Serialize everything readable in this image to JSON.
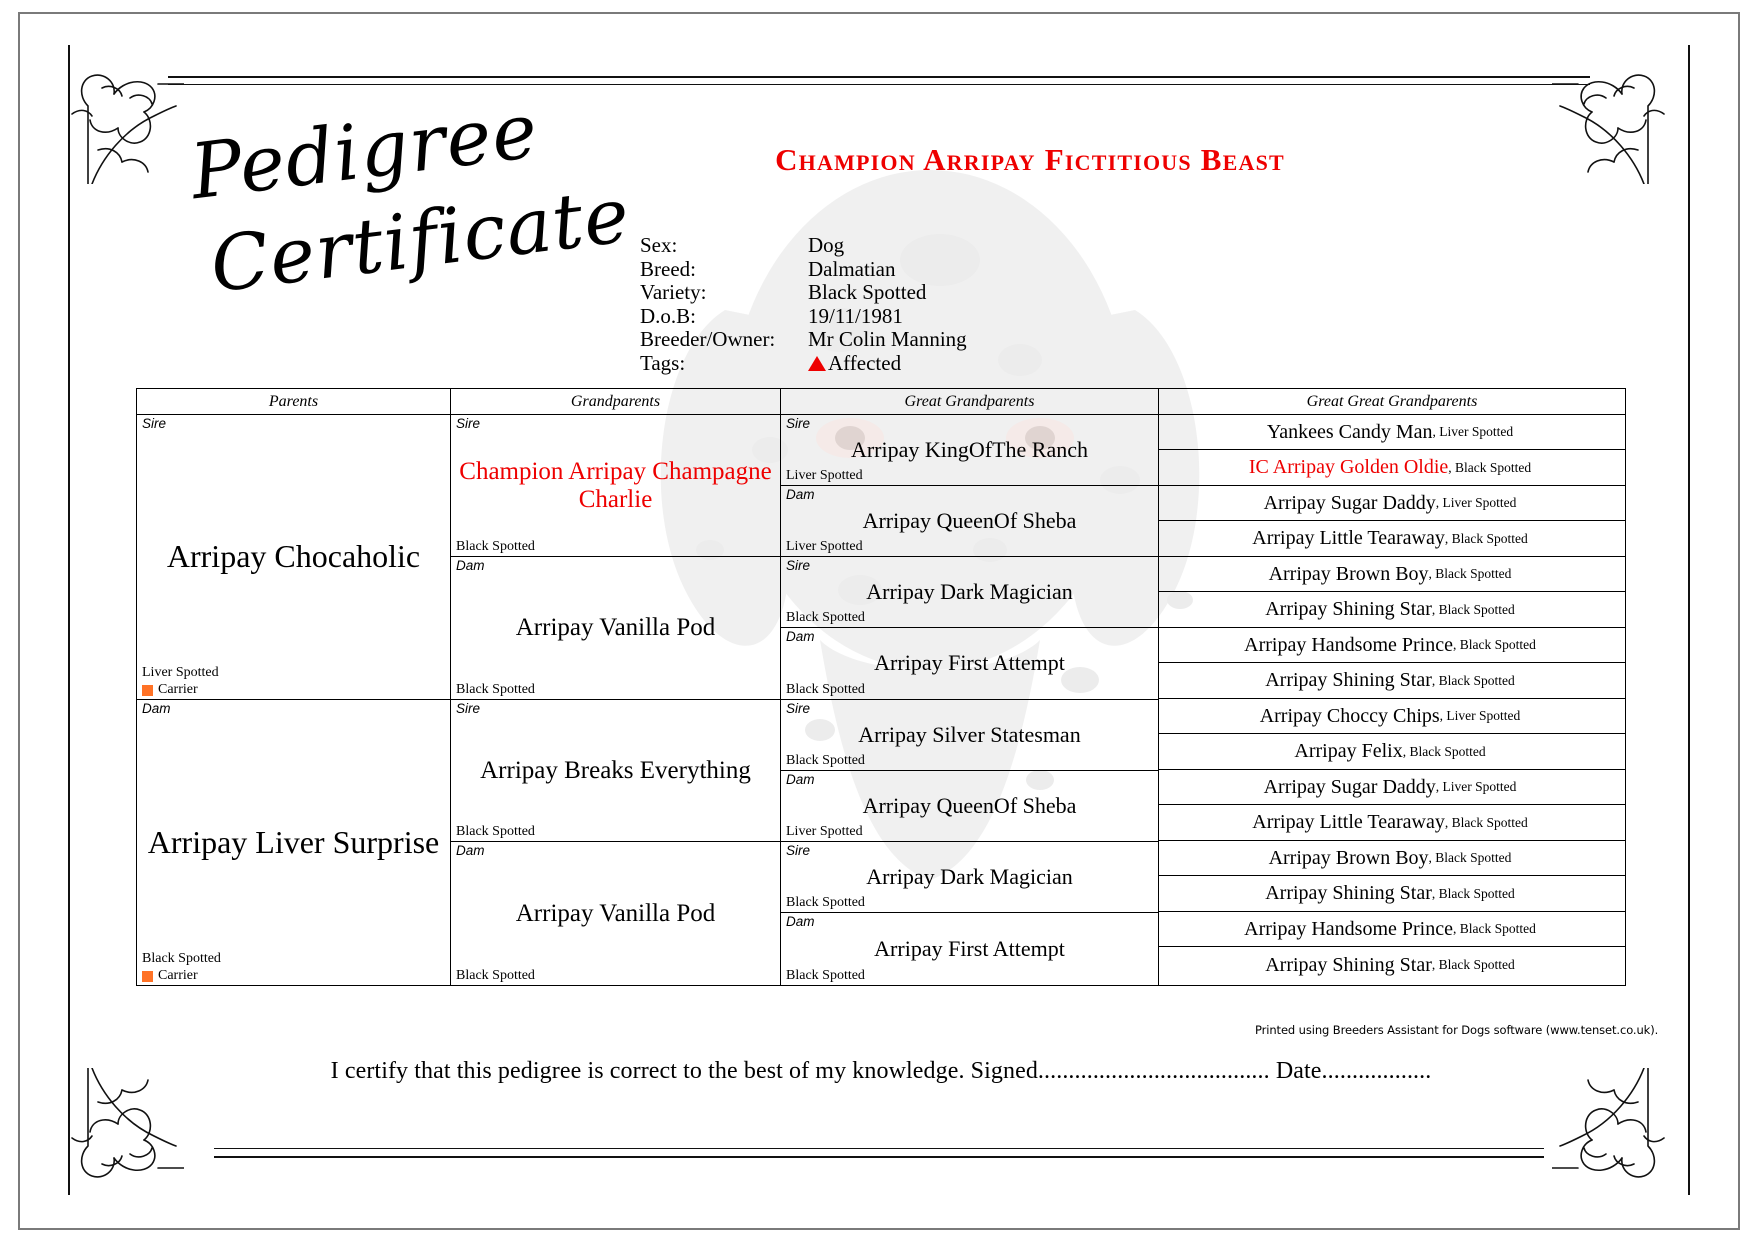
{
  "document": {
    "title_line1": "Pedigree",
    "title_line2": "Certificate",
    "dog_name": "Champion Arripay  Fictitious Beast",
    "accent_red": "#ee0000",
    "carrier_orange": "#ff7226",
    "printed_by": "Printed using Breeders Assistant for Dogs software (www.tenset.co.uk).",
    "certify_line": "I certify that this pedigree is correct to the best of my knowledge. Signed...................................... Date.................."
  },
  "meta": {
    "rows": [
      {
        "label": "Sex:",
        "value": "Dog"
      },
      {
        "label": "Breed:",
        "value": "Dalmatian"
      },
      {
        "label": "Variety:",
        "value": "Black Spotted"
      },
      {
        "label": "D.o.B:",
        "value": "19/11/1981"
      },
      {
        "label": "Breeder/Owner:",
        "value": "Mr Colin Manning"
      },
      {
        "label": "Tags:",
        "value": "Affected"
      }
    ]
  },
  "table": {
    "headers": [
      "Parents",
      "Grandparents",
      "Great Grandparents",
      "Great Great Grandparents"
    ]
  },
  "parents": [
    {
      "role": "Sire",
      "name": "Arripay Chocaholic",
      "variety": "Liver Spotted",
      "carrier": "Carrier",
      "red": false
    },
    {
      "role": "Dam",
      "name": "Arripay Liver Surprise",
      "variety": "Black Spotted",
      "carrier": "Carrier",
      "red": false
    }
  ],
  "grandparents": [
    {
      "role": "Sire",
      "name": "Champion Arripay Champagne Charlie",
      "variety": "Black Spotted",
      "red": true
    },
    {
      "role": "Dam",
      "name": "Arripay Vanilla Pod",
      "variety": "Black Spotted",
      "red": false
    },
    {
      "role": "Sire",
      "name": "Arripay Breaks Everything",
      "variety": "Black Spotted",
      "red": false
    },
    {
      "role": "Dam",
      "name": "Arripay Vanilla Pod",
      "variety": "Black Spotted",
      "red": false
    }
  ],
  "great_grandparents": [
    {
      "role": "Sire",
      "name": "Arripay KingOfThe Ranch",
      "variety": "Liver Spotted",
      "red": false
    },
    {
      "role": "Dam",
      "name": "Arripay QueenOf Sheba",
      "variety": "Liver Spotted",
      "red": false
    },
    {
      "role": "Sire",
      "name": "Arripay Dark Magician",
      "variety": "Black Spotted",
      "red": false
    },
    {
      "role": "Dam",
      "name": "Arripay First Attempt",
      "variety": "Black Spotted",
      "red": false
    },
    {
      "role": "Sire",
      "name": "Arripay Silver Statesman",
      "variety": "Black Spotted",
      "red": false
    },
    {
      "role": "Dam",
      "name": "Arripay QueenOf Sheba",
      "variety": "Liver Spotted",
      "red": false
    },
    {
      "role": "Sire",
      "name": "Arripay Dark Magician",
      "variety": "Black Spotted",
      "red": false
    },
    {
      "role": "Dam",
      "name": "Arripay First Attempt",
      "variety": "Black Spotted",
      "red": false
    }
  ],
  "great_great_grandparents": [
    {
      "name": "Yankees Candy Man",
      "variety": "Liver Spotted",
      "red": false
    },
    {
      "name": "IC Arripay Golden Oldie",
      "variety": "Black Spotted",
      "red": true
    },
    {
      "name": "Arripay Sugar Daddy",
      "variety": "Liver Spotted",
      "red": false
    },
    {
      "name": "Arripay Little Tearaway",
      "variety": "Black Spotted",
      "red": false
    },
    {
      "name": "Arripay Brown Boy",
      "variety": "Black Spotted",
      "red": false
    },
    {
      "name": "Arripay Shining Star",
      "variety": "Black Spotted",
      "red": false
    },
    {
      "name": "Arripay Handsome Prince",
      "variety": "Black Spotted",
      "red": false
    },
    {
      "name": "Arripay Shining Star",
      "variety": "Black Spotted",
      "red": false
    },
    {
      "name": "Arripay Choccy Chips",
      "variety": "Liver Spotted",
      "red": false
    },
    {
      "name": "Arripay Felix",
      "variety": "Black Spotted",
      "red": false
    },
    {
      "name": "Arripay Sugar Daddy",
      "variety": "Liver Spotted",
      "red": false
    },
    {
      "name": "Arripay Little Tearaway",
      "variety": "Black Spotted",
      "red": false
    },
    {
      "name": "Arripay Brown Boy",
      "variety": "Black Spotted",
      "red": false
    },
    {
      "name": "Arripay Shining Star",
      "variety": "Black Spotted",
      "red": false
    },
    {
      "name": "Arripay Handsome Prince",
      "variety": "Black Spotted",
      "red": false
    },
    {
      "name": "Arripay Shining Star",
      "variety": "Black Spotted",
      "red": false
    }
  ]
}
